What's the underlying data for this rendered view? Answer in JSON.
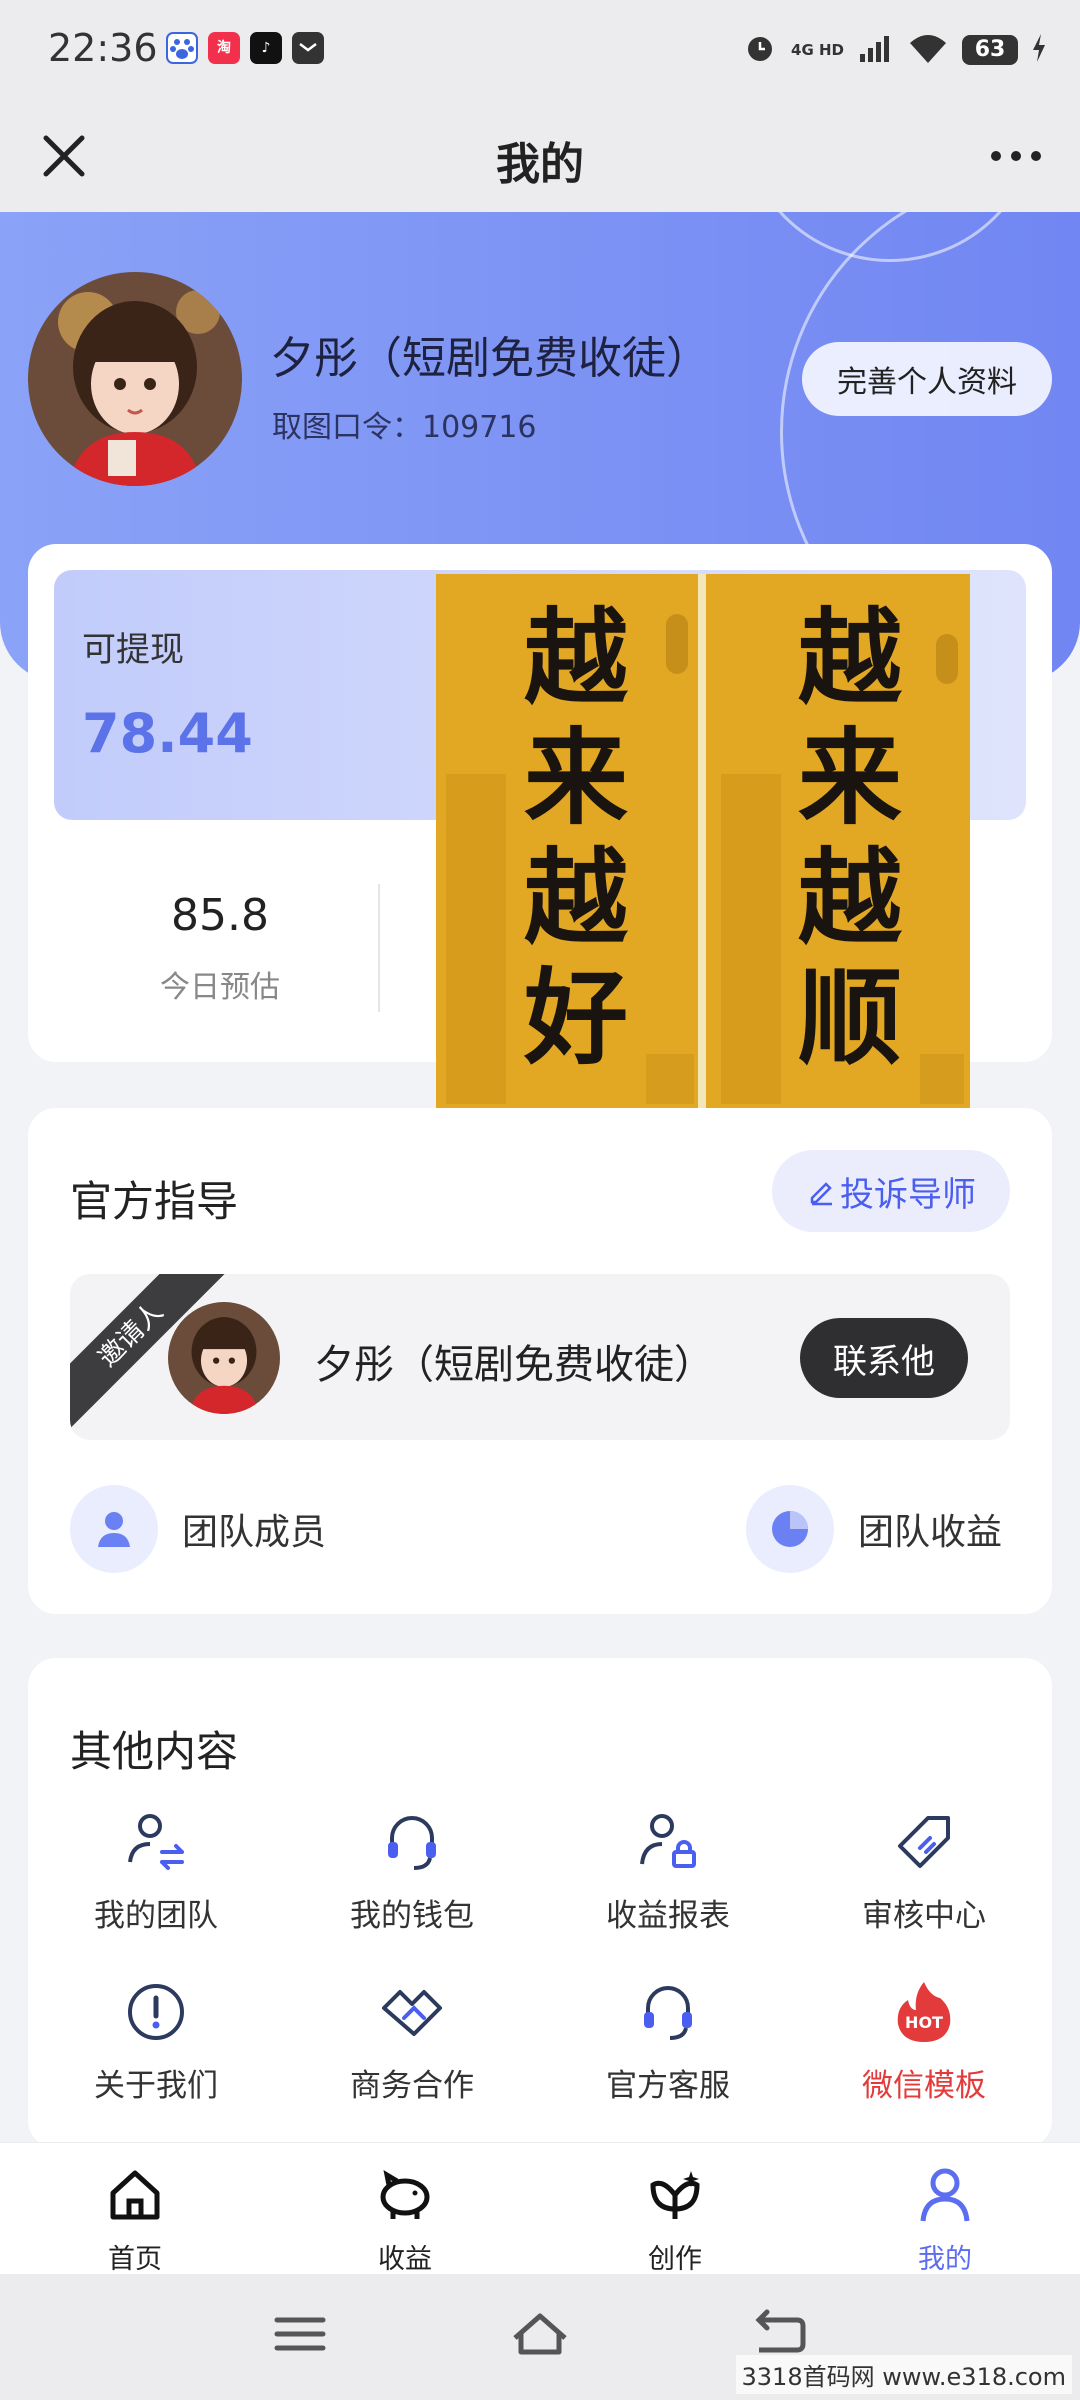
{
  "status_bar": {
    "time": "22:36",
    "network": "4G HD",
    "battery": "63",
    "app_icons": [
      "baidu-icon",
      "taobao-icon",
      "tiktok-icon",
      "message-icon"
    ]
  },
  "title_bar": {
    "title": "我的"
  },
  "profile": {
    "name": "夕彤（短剧免费收徒）",
    "code": "取图口令：109716",
    "complete_button": "完善个人资料"
  },
  "wallet": {
    "withdraw_label": "可提现",
    "withdraw_value": "78.44",
    "stats": [
      {
        "value": "85.8",
        "label": "今日预估"
      }
    ]
  },
  "guidance": {
    "title": "官方指导",
    "complain_button": "投诉导师",
    "inviter_badge": "邀请人",
    "inviter_name": "夕彤（短剧免费收徒）",
    "contact_button": "联系他",
    "team_members": "团队成员",
    "team_earnings": "团队收益"
  },
  "other": {
    "title": "其他内容",
    "items": [
      {
        "label": "我的团队",
        "icon": "team-icon"
      },
      {
        "label": "我的钱包",
        "icon": "headset-icon"
      },
      {
        "label": "收益报表",
        "icon": "user-lock-icon"
      },
      {
        "label": "审核中心",
        "icon": "tag-icon"
      },
      {
        "label": "关于我们",
        "icon": "info-icon"
      },
      {
        "label": "商务合作",
        "icon": "handshake-icon"
      },
      {
        "label": "官方客服",
        "icon": "headset-icon"
      },
      {
        "label": "微信模板",
        "icon": "hot-icon"
      }
    ]
  },
  "tabs": [
    {
      "label": "首页",
      "icon": "home-icon"
    },
    {
      "label": "收益",
      "icon": "piggy-bank-icon"
    },
    {
      "label": "创作",
      "icon": "leaf-icon"
    },
    {
      "label": "我的",
      "icon": "user-icon",
      "active": true
    }
  ],
  "image_text": {
    "left": "越来越好",
    "right": "越来越顺"
  },
  "watermark": "3318首码网 www.e318.com",
  "colors": {
    "accent": "#5b6ef0",
    "header_gradient_start": "#8aa2f7",
    "header_gradient_end": "#7186f2",
    "hot": "#e33b3b"
  }
}
